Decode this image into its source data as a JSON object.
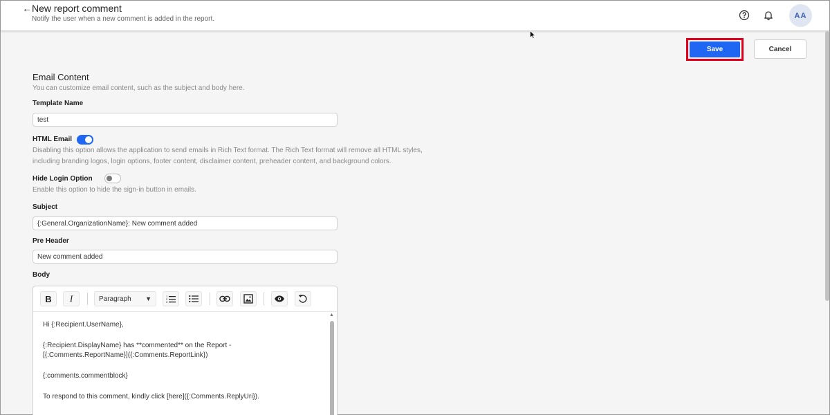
{
  "header": {
    "back_icon": "arrow-left-icon",
    "title": "New report comment",
    "subtitle": "Notify the user when a new comment is added in the report.",
    "help_icon": "help-circle-icon",
    "bell_icon": "bell-icon",
    "avatar_initials": "AA"
  },
  "actions": {
    "save_label": "Save",
    "cancel_label": "Cancel",
    "save_color": "#1f66f2",
    "highlight_color": "#e0001b"
  },
  "email_content": {
    "title": "Email Content",
    "description": "You can customize email content, such as the subject and body here."
  },
  "fields": {
    "template_name_label": "Template Name",
    "template_name_value": "test",
    "html_email_label": "HTML Email",
    "html_email_enabled": true,
    "html_email_help_line1": "Disabling this option allows the application to send emails in Rich Text format. The Rich Text format will remove all HTML styles,",
    "html_email_help_line2": "including branding logos, login options, footer content, disclaimer content, preheader content, and background colors.",
    "hide_login_label": "Hide Login Option",
    "hide_login_enabled": false,
    "hide_login_help": "Enable this option to hide the sign-in button in emails.",
    "subject_label": "Subject",
    "subject_value": "{:General.OrganizationName}: New comment added",
    "preheader_label": "Pre Header",
    "preheader_value": "New comment added",
    "body_label": "Body"
  },
  "editor": {
    "toolbar": {
      "bold": "B",
      "italic": "I",
      "paragraph_select": "Paragraph",
      "ordered_list_icon": "ordered-list-icon",
      "bullet_list_icon": "bullet-list-icon",
      "link_icon": "link-icon",
      "image_icon": "image-icon",
      "preview_icon": "eye-icon",
      "reset_icon": "reset-icon"
    },
    "lines": [
      "Hi {:Recipient.UserName},",
      "{:Recipient.DisplayName} has **commented** on the Report -",
      "[{:Comments.ReportName}]({:Comments.ReportLink})",
      "{:comments.commentblock}",
      "To respond to this comment, kindly click [here]({:Comments.ReplyUri})."
    ]
  }
}
